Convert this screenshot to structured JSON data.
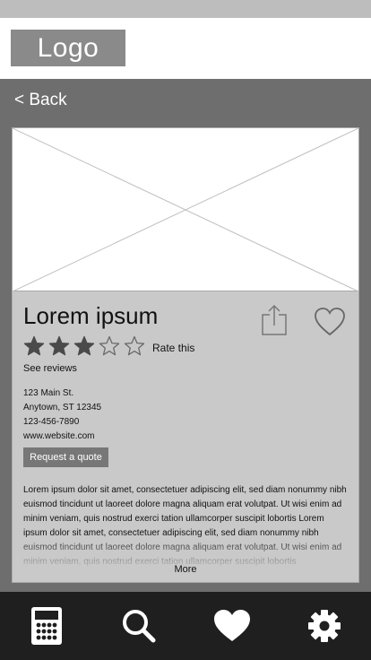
{
  "header": {
    "logo_text": "Logo"
  },
  "nav": {
    "back_label": "< Back"
  },
  "listing": {
    "title": "Lorem ipsum",
    "rating": {
      "value": 3,
      "max": 5
    },
    "rate_label": "Rate this",
    "reviews_link": "See reviews",
    "address": {
      "street": "123 Main St.",
      "city_state_zip": "Anytown, ST 12345",
      "phone": "123-456-7890",
      "website": "www.website.com"
    },
    "quote_button_label": "Request a quote",
    "description": "Lorem ipsum dolor sit amet, consectetuer adipiscing elit, sed diam nonummy nibh euismod tincidunt ut laoreet dolore magna aliquam erat volutpat. Ut wisi enim ad minim veniam, quis nostrud exerci tation ullamcorper suscipit lobortis Lorem ipsum dolor sit amet, consectetuer adipiscing elit, sed diam nonummy nibh euismod tincidunt ut laoreet dolore magna aliquam erat volutpat. Ut wisi enim ad minim veniam, quis nostrud exerci tation ullamcorper suscipit lobortis",
    "more_label": "More"
  },
  "bottom_nav": [
    {
      "icon": "calculator-icon"
    },
    {
      "icon": "search-icon"
    },
    {
      "icon": "heart-icon"
    },
    {
      "icon": "gear-icon"
    }
  ],
  "colors": {
    "status_bar": "#bdbdbd",
    "page_background": "#6e6e6e",
    "card_background": "#c9c9c9",
    "logo_background": "#8a8a8a",
    "button_background": "#777777",
    "bottom_nav_background": "#1f1f1f"
  }
}
